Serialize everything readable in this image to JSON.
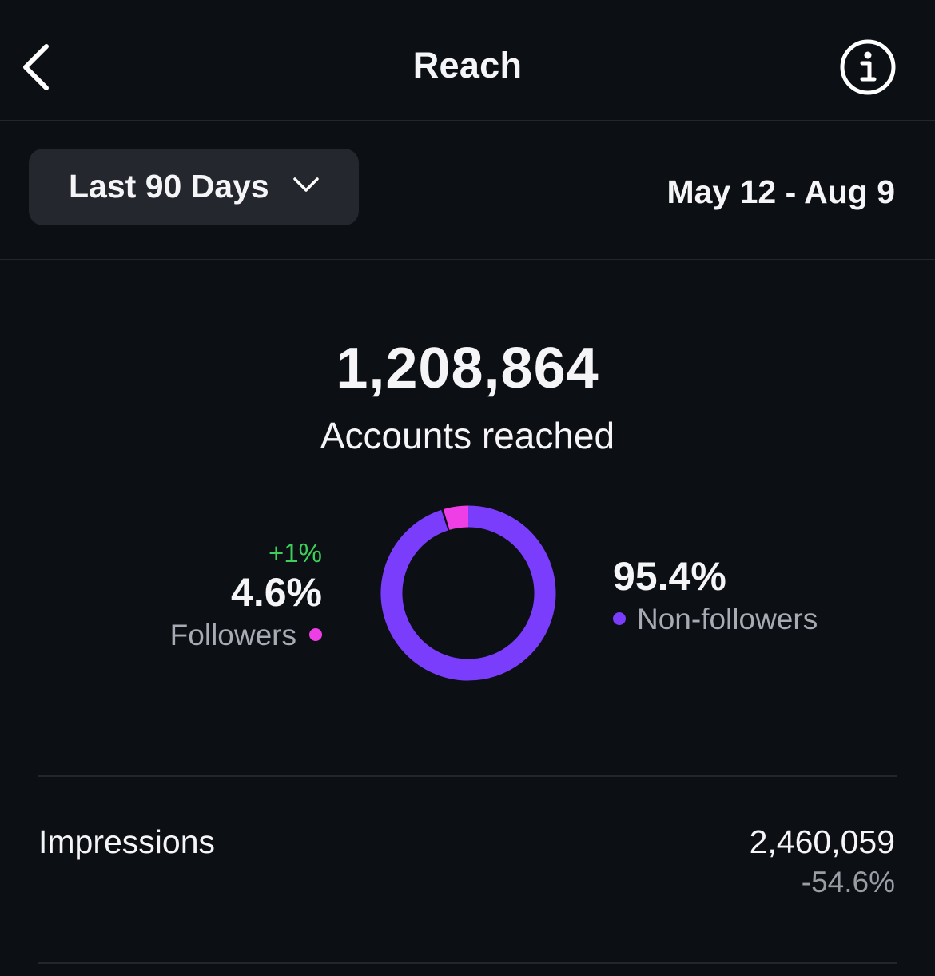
{
  "header": {
    "title": "Reach",
    "back_icon": "chevron-left-icon",
    "info_icon": "info-circle-icon"
  },
  "filter": {
    "range_label": "Last 90 Days",
    "range_icon": "chevron-down-icon",
    "date_range": "May 12 - Aug 9"
  },
  "summary": {
    "value": "1,208,864",
    "label": "Accounts reached"
  },
  "breakdown": {
    "followers": {
      "change": "+1%",
      "percent": "4.6%",
      "label": "Followers",
      "share": 4.6,
      "color": "#ee3ee6"
    },
    "non_followers": {
      "percent": "95.4%",
      "label": "Non-followers",
      "share": 95.4,
      "color": "#7a3dfb"
    }
  },
  "impressions": {
    "label": "Impressions",
    "value": "2,460,059",
    "change": "-54.6%"
  },
  "colors": {
    "background": "#0c0f14",
    "dropdown_bg": "#24272d",
    "positive": "#3ecf5b",
    "muted_text": "#a8abb3"
  }
}
